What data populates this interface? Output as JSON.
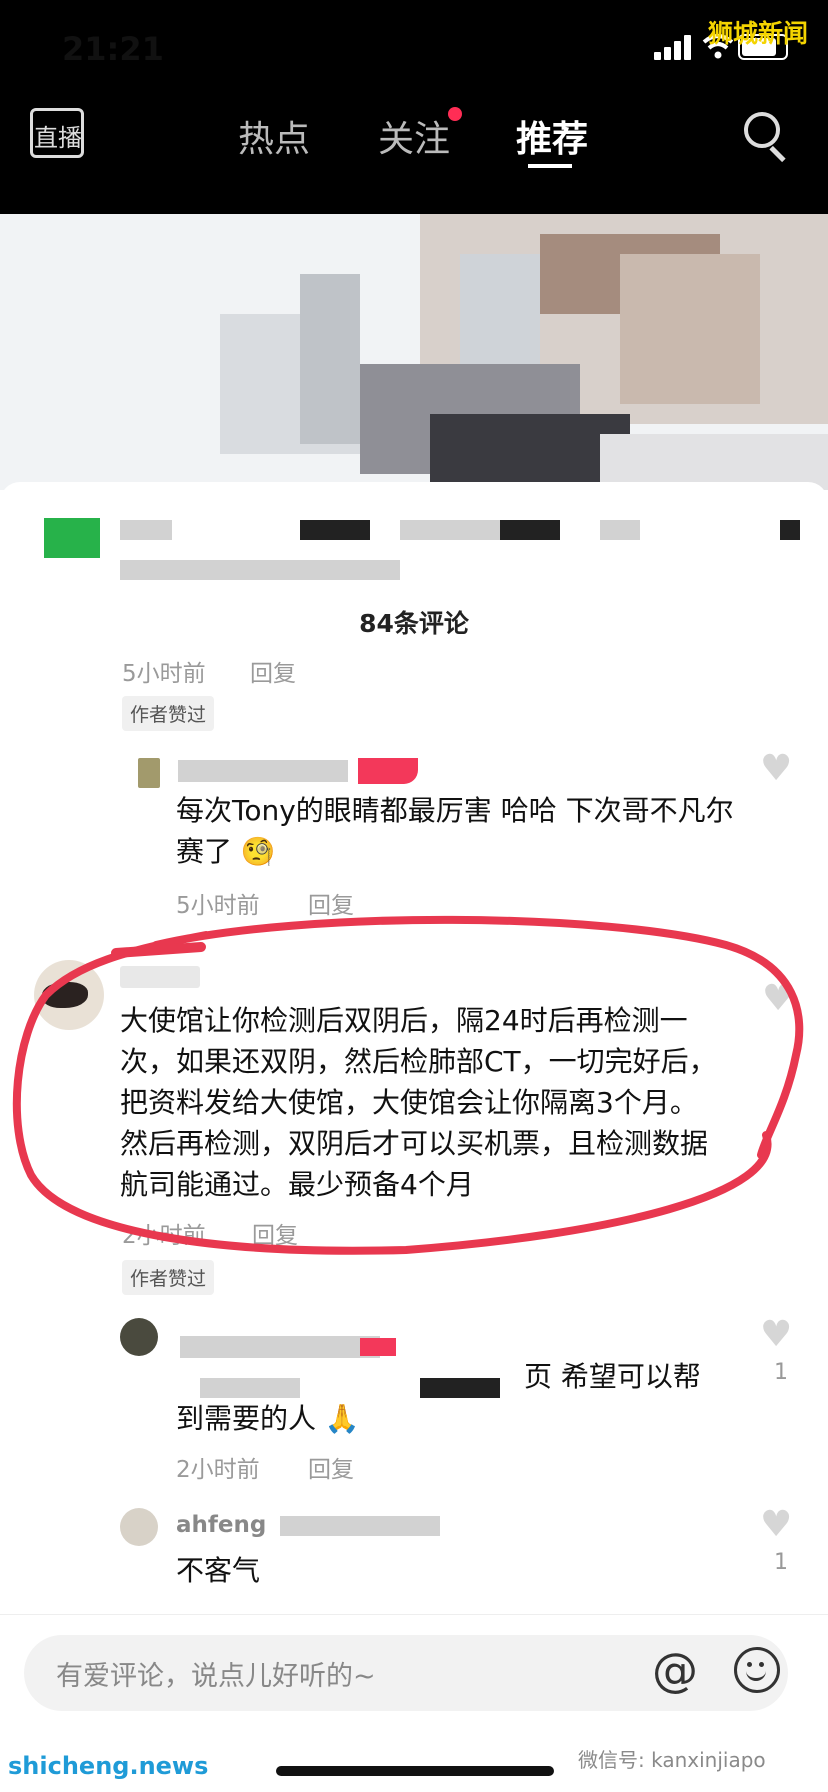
{
  "status_bar": {
    "time": "21:21",
    "watermark": "狮城新闻"
  },
  "nav": {
    "live_label": "直播",
    "tabs": [
      {
        "label": "热点"
      },
      {
        "label": "关注"
      },
      {
        "label": "推荐"
      }
    ],
    "active_tab": "推荐",
    "search_icon": "search-icon"
  },
  "comments_panel": {
    "count_label": "84条评论",
    "comments": [
      {
        "time": "5小时前",
        "reply_label": "回复",
        "badge": "作者赞过"
      },
      {
        "text": "每次Tony的眼睛都最厉害 哈哈 下次哥不凡尔赛了 🧐",
        "time": "5小时前",
        "reply_label": "回复"
      },
      {
        "text": "大使馆让你检测后双阴后，隔24时后再检测一次，如果还双阴，然后检肺部CT，一切完好后，把资料发给大使馆，大使馆会让你隔离3个月。然后再检测，双阴后才可以买机票，且检测数据航司能通过。最少预备4个月",
        "time": "2小时前",
        "reply_label": "回复",
        "badge": "作者赞过"
      },
      {
        "text_tail": "页 希望可以帮",
        "text_line2": "到需要的人 🙏",
        "time": "2小时前",
        "reply_label": "回复",
        "likes": "1"
      },
      {
        "username": "ahfeng",
        "text": "不客气",
        "likes": "1"
      }
    ]
  },
  "input": {
    "placeholder": "有爱评论，说点儿好听的~",
    "at_symbol": "@"
  },
  "watermarks": {
    "bottom_left": "shicheng.news",
    "bottom_right": "微信号: kanxinjiapo"
  },
  "colors": {
    "accent_red": "#ff2d55",
    "annotation_red": "#e8384f",
    "watermark_yellow": "#f4d400",
    "watermark_blue": "#1f9bd7"
  }
}
